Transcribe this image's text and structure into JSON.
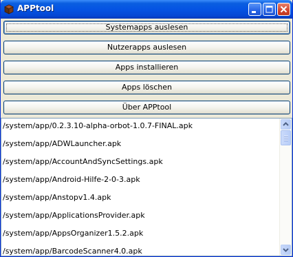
{
  "window": {
    "title": "APPtool",
    "icon": "app-cube-icon",
    "controls": [
      "minimize-icon",
      "maximize-icon",
      "close-icon"
    ]
  },
  "buttons": {
    "systemapps": "Systemapps auslesen",
    "nutzerapps": "Nutzerapps auslesen",
    "install": "Apps installieren",
    "delete": "Apps löschen",
    "about": "Über APPtool"
  },
  "app_list": {
    "items": [
      "/system/app/0.2.3.10-alpha-orbot-1.0.7-FINAL.apk",
      "/system/app/ADWLauncher.apk",
      "/system/app/AccountAndSyncSettings.apk",
      "/system/app/Android-Hilfe-2-0-3.apk",
      "/system/app/Anstopv1.4.apk",
      "/system/app/ApplicationsProvider.apk",
      "/system/app/AppsOrganizer1.5.2.apk",
      "/system/app/BarcodeScanner4.0.apk"
    ]
  },
  "colors": {
    "titlebar": "#0554e3",
    "window_bg": "#ece9d8",
    "list_bg": "#ffffff"
  }
}
